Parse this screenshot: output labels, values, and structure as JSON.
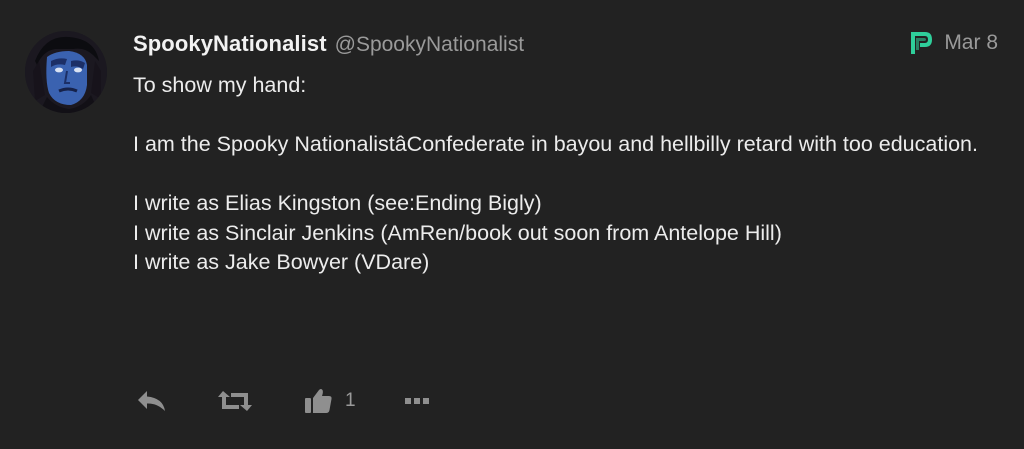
{
  "post": {
    "display_name": "SpookyNationalist",
    "handle": "@SpookyNationalist",
    "date": "Mar 8",
    "platform_icon": "platform-logo-icon",
    "content": [
      "To show my hand:",
      "",
      "I am the Spooky NationalistâConfederate in bayou and hellbilly retard with too education.",
      "",
      "I write as Elias Kingston (see:Ending Bigly)",
      "I write as Sinclair Jenkins (AmRen/book out soon from Antelope Hill)",
      "I write as Jake Bowyer (VDare)"
    ]
  },
  "actions": {
    "reply_icon": "reply-icon",
    "repost_icon": "repost-icon",
    "like_icon": "thumbs-up-icon",
    "like_count": "1",
    "more_icon": "more-options-icon"
  },
  "colors": {
    "background": "#222222",
    "text_primary": "#ececec",
    "text_secondary": "#9a9a9a",
    "brand_accent": "#2fcf9b"
  }
}
